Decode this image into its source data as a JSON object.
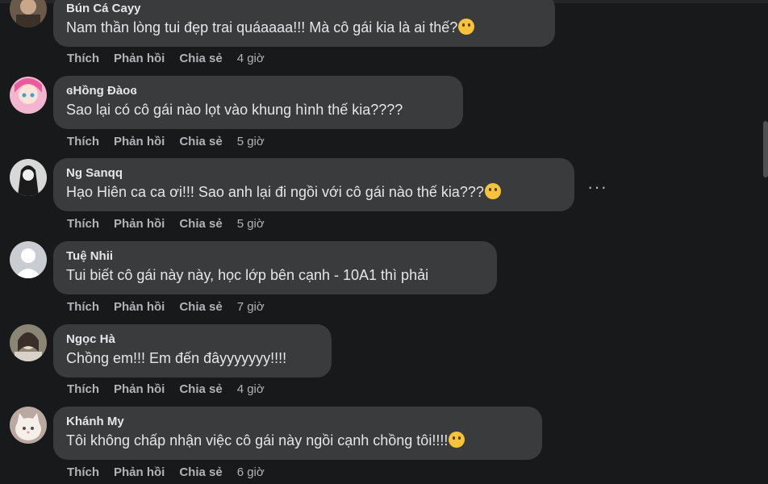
{
  "action_labels": {
    "like": "Thích",
    "reply": "Phản hồi",
    "share": "Chia sẻ"
  },
  "comments": [
    {
      "name": "Bún Cá Cayy",
      "text": "Nam thần lòng tui đẹp trai quáaaaa!!! Mà cô gái kia là ai thế?",
      "emoji": "smirk-emoji",
      "time": "4 giờ"
    },
    {
      "name": "ɞHồng Đàoɞ",
      "text": "Sao lại có cô gái nào lọt vào khung hình thế kia????",
      "emoji": "",
      "time": "5 giờ"
    },
    {
      "name": "Ng Sanqq",
      "text": "Hạo Hiên ca ca ơi!!! Sao anh lại đi ngồi với cô gái nào thế kia???",
      "emoji": "pleading-emoji",
      "time": "5 giờ"
    },
    {
      "name": "Tuệ Nhii",
      "text": "Tui biết cô gái này này, học lớp bên cạnh - 10A1 thì phải",
      "emoji": "",
      "time": "7 giờ"
    },
    {
      "name": "Ngọc Hà",
      "text": "Chồng em!!! Em đến đâyyyyyyy!!!!",
      "emoji": "",
      "time": "4 giờ"
    },
    {
      "name": "Khánh My",
      "text": "Tôi không chấp nhận việc cô gái này ngồi cạnh chồng tôi!!!!",
      "emoji": "sad-emoji",
      "time": "6 giờ"
    }
  ],
  "more_options": "···",
  "colors": {
    "background": "#18191a",
    "bubble": "#3a3b3c",
    "text": "#e4e6eb",
    "secondary": "#b0b3b8"
  }
}
